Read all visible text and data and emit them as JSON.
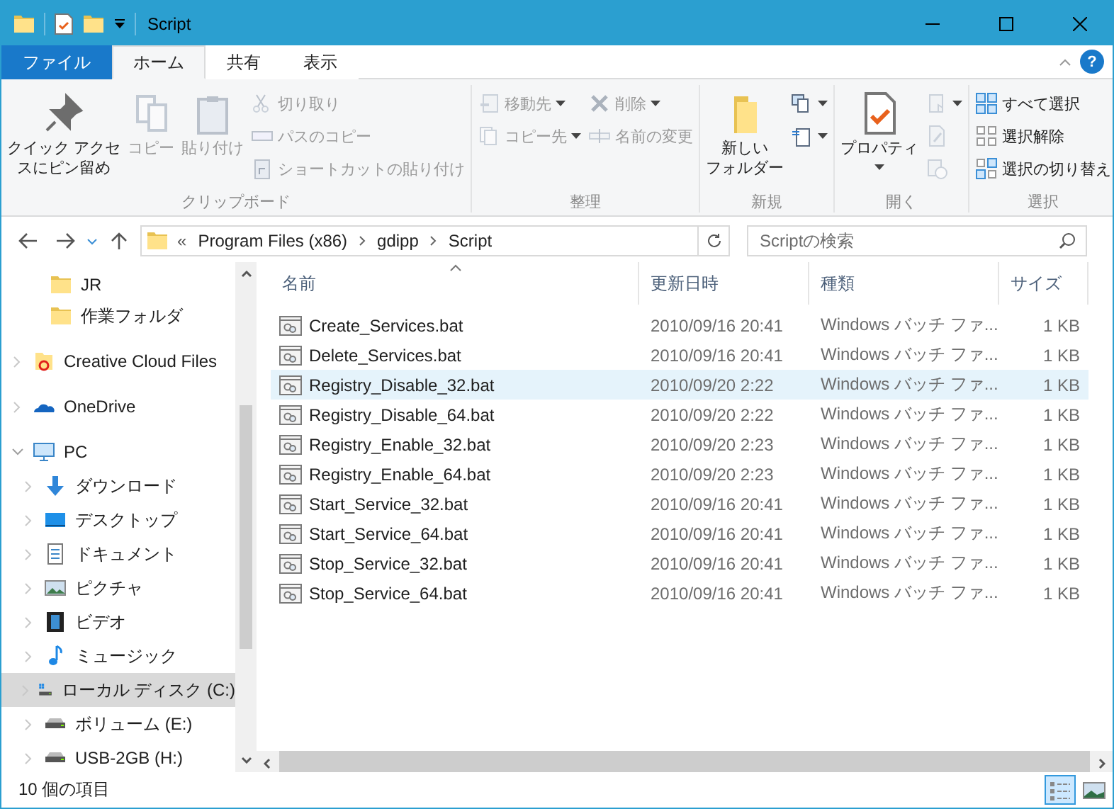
{
  "window": {
    "title": "Script"
  },
  "ribbon": {
    "tabs": [
      {
        "label": "ファイル",
        "kind": "file",
        "selected": false
      },
      {
        "label": "ホーム",
        "kind": "tab",
        "selected": true
      },
      {
        "label": "共有",
        "kind": "tab",
        "selected": false
      },
      {
        "label": "表示",
        "kind": "tab",
        "selected": false
      }
    ],
    "help": "?",
    "groups": [
      {
        "label": "クリップボード",
        "columns": [
          {
            "kind": "large",
            "items": [
              {
                "kind": "pin",
                "label_lines": [
                  "クイック アクセ",
                  "スにピン留め"
                ],
                "disabled": false
              }
            ]
          },
          {
            "kind": "large",
            "items": [
              {
                "kind": "copy",
                "label_lines": [
                  "コピー"
                ],
                "disabled": true
              }
            ]
          },
          {
            "kind": "large",
            "items": [
              {
                "kind": "paste",
                "label_lines": [
                  "貼り付け"
                ],
                "disabled": true
              }
            ]
          },
          {
            "kind": "stack",
            "items": [
              {
                "kind": "scissors",
                "label": "切り取り",
                "disabled": true
              },
              {
                "kind": "path",
                "label": "パスのコピー",
                "disabled": true
              },
              {
                "kind": "shortcut",
                "label": "ショートカットの貼り付け",
                "disabled": true
              }
            ]
          }
        ]
      },
      {
        "label": "整理",
        "columns": [
          {
            "kind": "stack",
            "items": [
              {
                "kind": "move",
                "label": "移動先",
                "disabled": true,
                "dropdown": true
              },
              {
                "kind": "copyto",
                "label": "コピー先",
                "disabled": true,
                "dropdown": true
              }
            ]
          },
          {
            "kind": "stack",
            "items": [
              {
                "kind": "delete",
                "label": "削除",
                "disabled": true,
                "dropdown": true
              },
              {
                "kind": "rename",
                "label": "名前の変更",
                "disabled": true
              }
            ]
          }
        ]
      },
      {
        "label": "新規",
        "columns": [
          {
            "kind": "large",
            "items": [
              {
                "kind": "folder",
                "label_lines": [
                  "新しい",
                  "フォルダー"
                ],
                "disabled": false
              }
            ]
          },
          {
            "kind": "stack",
            "items": [
              {
                "kind": "newitem",
                "disabled": false,
                "dropdown": true
              },
              {
                "kind": "easyaccess",
                "disabled": false,
                "dropdown": true
              }
            ]
          }
        ]
      },
      {
        "label": "開く",
        "columns": [
          {
            "kind": "large",
            "items": [
              {
                "kind": "properties",
                "label_lines": [
                  "プロパティ"
                ],
                "disabled": false,
                "dropdown": true
              }
            ]
          },
          {
            "kind": "stack",
            "items": [
              {
                "kind": "open",
                "disabled": true,
                "dropdown": true
              },
              {
                "kind": "edit",
                "disabled": true
              },
              {
                "kind": "history",
                "disabled": true
              }
            ]
          }
        ]
      },
      {
        "label": "選択",
        "columns": [
          {
            "kind": "stack",
            "items": [
              {
                "kind": "selectall",
                "label": "すべて選択",
                "disabled": false
              },
              {
                "kind": "selectnone",
                "label": "選択解除",
                "disabled": false
              },
              {
                "kind": "invert",
                "label": "選択の切り替え",
                "disabled": false
              }
            ]
          }
        ]
      }
    ]
  },
  "address": {
    "overflow": "«",
    "crumbs": [
      "Program Files (x86)",
      "gdipp",
      "Script"
    ]
  },
  "search": {
    "placeholder": "Scriptの検索"
  },
  "nav": {
    "quick_access_children": [
      {
        "label": "JR",
        "kind": "folder",
        "selected": false
      },
      {
        "label": "作業フォルダ",
        "kind": "folder",
        "selected": false
      }
    ],
    "items": [
      {
        "label": "Creative Cloud Files",
        "kind": "cc",
        "expanded": false,
        "selected": false
      },
      {
        "label": "OneDrive",
        "kind": "cloud",
        "expanded": false,
        "selected": false
      },
      {
        "label": "PC",
        "kind": "pc",
        "expanded": true,
        "selected": false,
        "children": [
          {
            "label": "ダウンロード",
            "kind": "download",
            "expanded": false,
            "selected": false
          },
          {
            "label": "デスクトップ",
            "kind": "desktop",
            "expanded": false,
            "selected": false
          },
          {
            "label": "ドキュメント",
            "kind": "document",
            "expanded": false,
            "selected": false
          },
          {
            "label": "ピクチャ",
            "kind": "pictures",
            "expanded": false,
            "selected": false
          },
          {
            "label": "ビデオ",
            "kind": "video",
            "expanded": false,
            "selected": false
          },
          {
            "label": "ミュージック",
            "kind": "music",
            "expanded": false,
            "selected": false
          },
          {
            "label": "ローカル ディスク (C:)",
            "kind": "systemdrive",
            "expanded": false,
            "selected": true
          },
          {
            "label": "ボリューム (E:)",
            "kind": "drive",
            "expanded": false,
            "selected": false
          },
          {
            "label": "USB-2GB (H:)",
            "kind": "drive",
            "expanded": false,
            "selected": false
          }
        ]
      }
    ]
  },
  "table": {
    "columns": [
      {
        "label": "名前",
        "sorted": true
      },
      {
        "label": "更新日時",
        "sorted": false
      },
      {
        "label": "種類",
        "sorted": false
      },
      {
        "label": "サイズ",
        "sorted": false
      }
    ],
    "rows": [
      {
        "name": "Create_Services.bat",
        "date": "2010/09/16 20:41",
        "type": "Windows バッチ ファ...",
        "size": "1 KB",
        "selected": false
      },
      {
        "name": "Delete_Services.bat",
        "date": "2010/09/16 20:41",
        "type": "Windows バッチ ファ...",
        "size": "1 KB",
        "selected": false
      },
      {
        "name": "Registry_Disable_32.bat",
        "date": "2010/09/20 2:22",
        "type": "Windows バッチ ファ...",
        "size": "1 KB",
        "selected": true
      },
      {
        "name": "Registry_Disable_64.bat",
        "date": "2010/09/20 2:22",
        "type": "Windows バッチ ファ...",
        "size": "1 KB",
        "selected": false
      },
      {
        "name": "Registry_Enable_32.bat",
        "date": "2010/09/20 2:23",
        "type": "Windows バッチ ファ...",
        "size": "1 KB",
        "selected": false
      },
      {
        "name": "Registry_Enable_64.bat",
        "date": "2010/09/20 2:23",
        "type": "Windows バッチ ファ...",
        "size": "1 KB",
        "selected": false
      },
      {
        "name": "Start_Service_32.bat",
        "date": "2010/09/16 20:41",
        "type": "Windows バッチ ファ...",
        "size": "1 KB",
        "selected": false
      },
      {
        "name": "Start_Service_64.bat",
        "date": "2010/09/16 20:41",
        "type": "Windows バッチ ファ...",
        "size": "1 KB",
        "selected": false
      },
      {
        "name": "Stop_Service_32.bat",
        "date": "2010/09/16 20:41",
        "type": "Windows バッチ ファ...",
        "size": "1 KB",
        "selected": false
      },
      {
        "name": "Stop_Service_64.bat",
        "date": "2010/09/16 20:41",
        "type": "Windows バッチ ファ...",
        "size": "1 KB",
        "selected": false
      }
    ]
  },
  "status": {
    "count": "10 個の項目",
    "views": [
      {
        "kind": "details",
        "selected": true
      },
      {
        "kind": "large_icons",
        "selected": false
      }
    ]
  }
}
